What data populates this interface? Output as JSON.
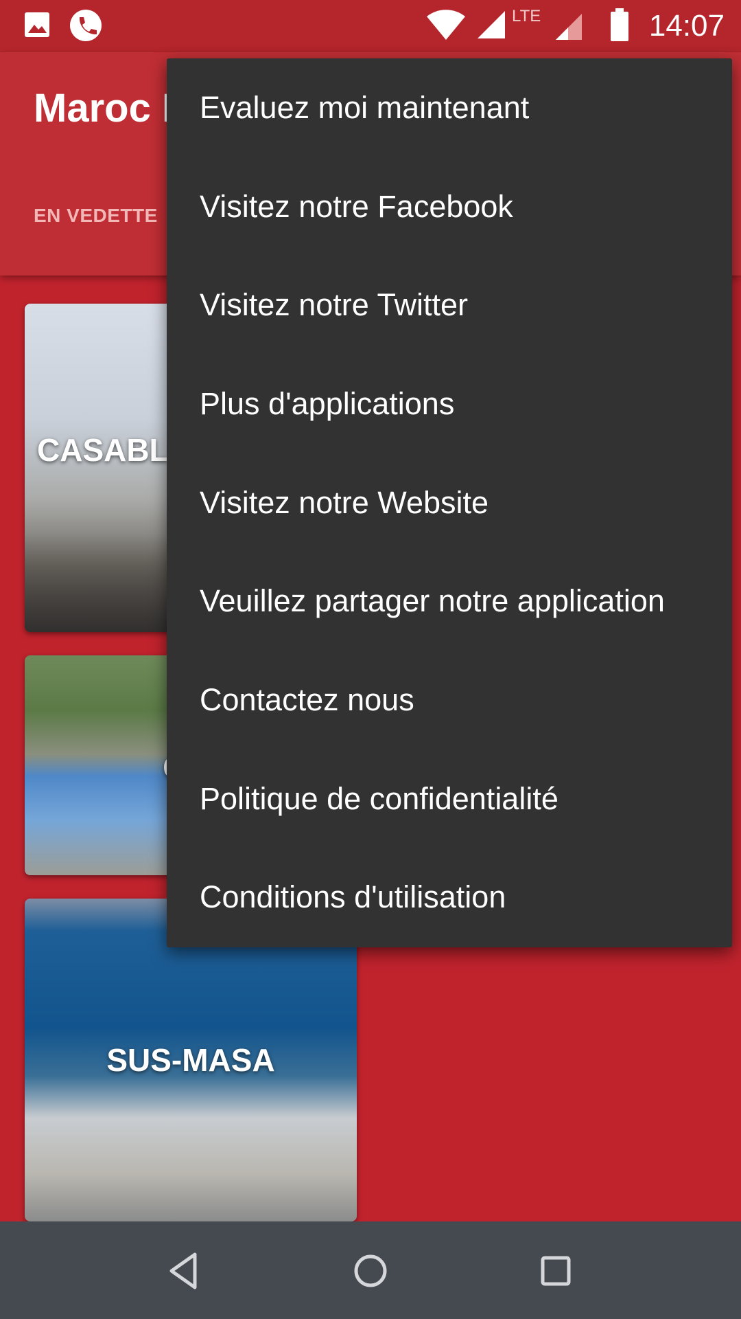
{
  "status_bar": {
    "time": "14:07",
    "network_label": "LTE",
    "icons": [
      "image-icon",
      "call-icon",
      "wifi-icon",
      "signal-icon",
      "lte-signal-icon",
      "battery-icon"
    ]
  },
  "app_bar": {
    "title": "Maroc I",
    "tabs": [
      {
        "label": "EN VEDETTE"
      }
    ]
  },
  "cards": [
    {
      "label": "CASABLA"
    },
    {
      "label": "ORI"
    },
    {
      "label": "SUS-MASA"
    }
  ],
  "menu": {
    "items": [
      {
        "label": "Evaluez moi maintenant"
      },
      {
        "label": "Visitez notre Facebook"
      },
      {
        "label": "Visitez notre Twitter"
      },
      {
        "label": "Plus d'applications"
      },
      {
        "label": "Visitez notre Website"
      },
      {
        "label": "Veuillez partager notre application"
      },
      {
        "label": "Contactez nous"
      },
      {
        "label": "Politique de confidentialité"
      },
      {
        "label": "Conditions d'utilisation"
      }
    ]
  },
  "nav_bar": {
    "buttons": [
      "back-icon",
      "home-icon",
      "recents-icon"
    ]
  },
  "colors": {
    "primary": "#c1232d",
    "app_bar": "#bf2e34",
    "menu_background": "#323232",
    "nav_bar": "#454a51"
  }
}
